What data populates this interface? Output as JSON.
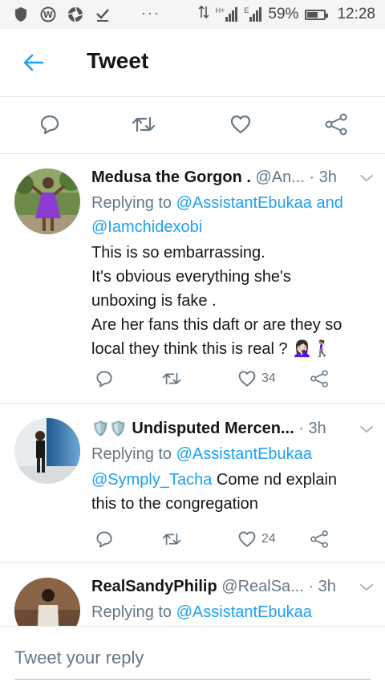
{
  "status": {
    "left_icons": [
      "shield-icon",
      "wordpress-icon",
      "aperture-icon",
      "check-icon"
    ],
    "overflow": "···",
    "network_small": "H+",
    "network_e": "E",
    "battery": "59%",
    "battery_level": 0.59,
    "time": "12:28"
  },
  "header": {
    "title": "Tweet"
  },
  "action_bar": [
    "reply-icon",
    "retweet-icon",
    "like-icon",
    "share-icon"
  ],
  "tweets": [
    {
      "name": "Medusa the Gorgon .",
      "handle": "@An...",
      "dot": "·",
      "time": "3h",
      "replying_prefix": "Replying to",
      "replying_to_1": "@AssistantEbukaa",
      "and": "and",
      "replying_to_2": "@Iamchidexobi",
      "lines": [
        "This is so embarrassing.",
        "It's obvious everything she's",
        "unboxing is fake .",
        "Are her fans this daft or are they so",
        "local they think this is real ? 🤦🏻‍♀️🚶🏽‍♀️"
      ],
      "likes": "34"
    },
    {
      "badges": "🛡️🛡️",
      "name": "Undisputed Mercen...",
      "dot": "·",
      "time": "3h",
      "replying_prefix": "Replying to",
      "replying_to_1": "@AssistantEbukaa",
      "mention": "@Symply_Tacha",
      "lines": [
        " Come nd explain",
        "this to the congregation"
      ],
      "likes": "24"
    },
    {
      "name": "RealSandyPhilip",
      "handle": "@RealSa...",
      "dot": "·",
      "time": "3h",
      "replying_prefix": "Replying to",
      "replying_to_1": "@AssistantEbukaa"
    }
  ],
  "reply_bar": {
    "placeholder": "Tweet your reply"
  },
  "colors": {
    "accent": "#1da1f2",
    "muted": "#657786",
    "text": "#14171a",
    "divider": "#e1e8ed"
  }
}
